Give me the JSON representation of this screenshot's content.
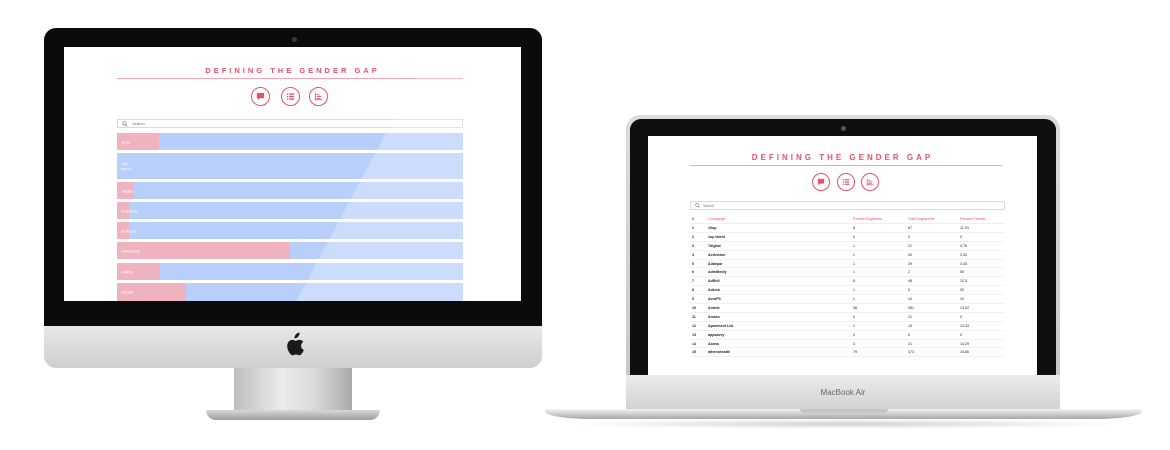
{
  "app": {
    "title": "DEFINING THE GENDER GAP",
    "accent_color": "#e9506a",
    "female_color": "#efb3c0",
    "total_color": "#b9cffb",
    "view_buttons": [
      {
        "name": "chat-icon"
      },
      {
        "name": "list-icon"
      },
      {
        "name": "bar-chart-icon"
      }
    ],
    "search": {
      "placeholder": "Search",
      "icon": "search-icon"
    }
  },
  "imac": {
    "bars": [
      {
        "label": "10up",
        "female_share": 0.12
      },
      {
        "label": "1up talent",
        "female_share": 0
      },
      {
        "label": "7digital",
        "female_share": 0.05
      },
      {
        "label": "Activision",
        "female_share": 0.035
      },
      {
        "label": "Addepar",
        "female_share": 0.035
      },
      {
        "label": "Admittedly",
        "female_share": 0.5
      },
      {
        "label": "AdRoll",
        "female_share": 0.125
      },
      {
        "label": "Adzerk",
        "female_share": 0.2
      }
    ]
  },
  "macbook": {
    "brand": "MacBook Air",
    "columns": [
      "#",
      "Company",
      "Female Engineers",
      "Total Engineers",
      "Percent Female"
    ],
    "rows": [
      [
        "1",
        "10up",
        "8",
        "67",
        "11.94"
      ],
      [
        "2",
        "1up talent",
        "0",
        "2",
        "0"
      ],
      [
        "3",
        "7digital",
        "1",
        "21",
        "4.76"
      ],
      [
        "4",
        "Activision",
        "1",
        "30",
        "3.33"
      ],
      [
        "5",
        "Addepar",
        "1",
        "29",
        "3.45"
      ],
      [
        "6",
        "Admittedly",
        "1",
        "2",
        "50"
      ],
      [
        "7",
        "AdRoll",
        "6",
        "48",
        "12.5"
      ],
      [
        "8",
        "Adzerk",
        "1",
        "5",
        "20"
      ],
      [
        "9",
        "AeroFS",
        "1",
        "10",
        "10"
      ],
      [
        "10",
        "Airbnb",
        "38",
        "281",
        "13.52"
      ],
      [
        "11",
        "Amaxs",
        "0",
        "21",
        "0"
      ],
      [
        "12",
        "Apartment List",
        "2",
        "15",
        "13.33"
      ],
      [
        "13",
        "appsavvy",
        "0",
        "5",
        "0"
      ],
      [
        "14",
        "Asana",
        "3",
        "21",
        "14.29"
      ],
      [
        "15",
        "athenahealth",
        "79",
        "473",
        "15.86"
      ]
    ]
  }
}
